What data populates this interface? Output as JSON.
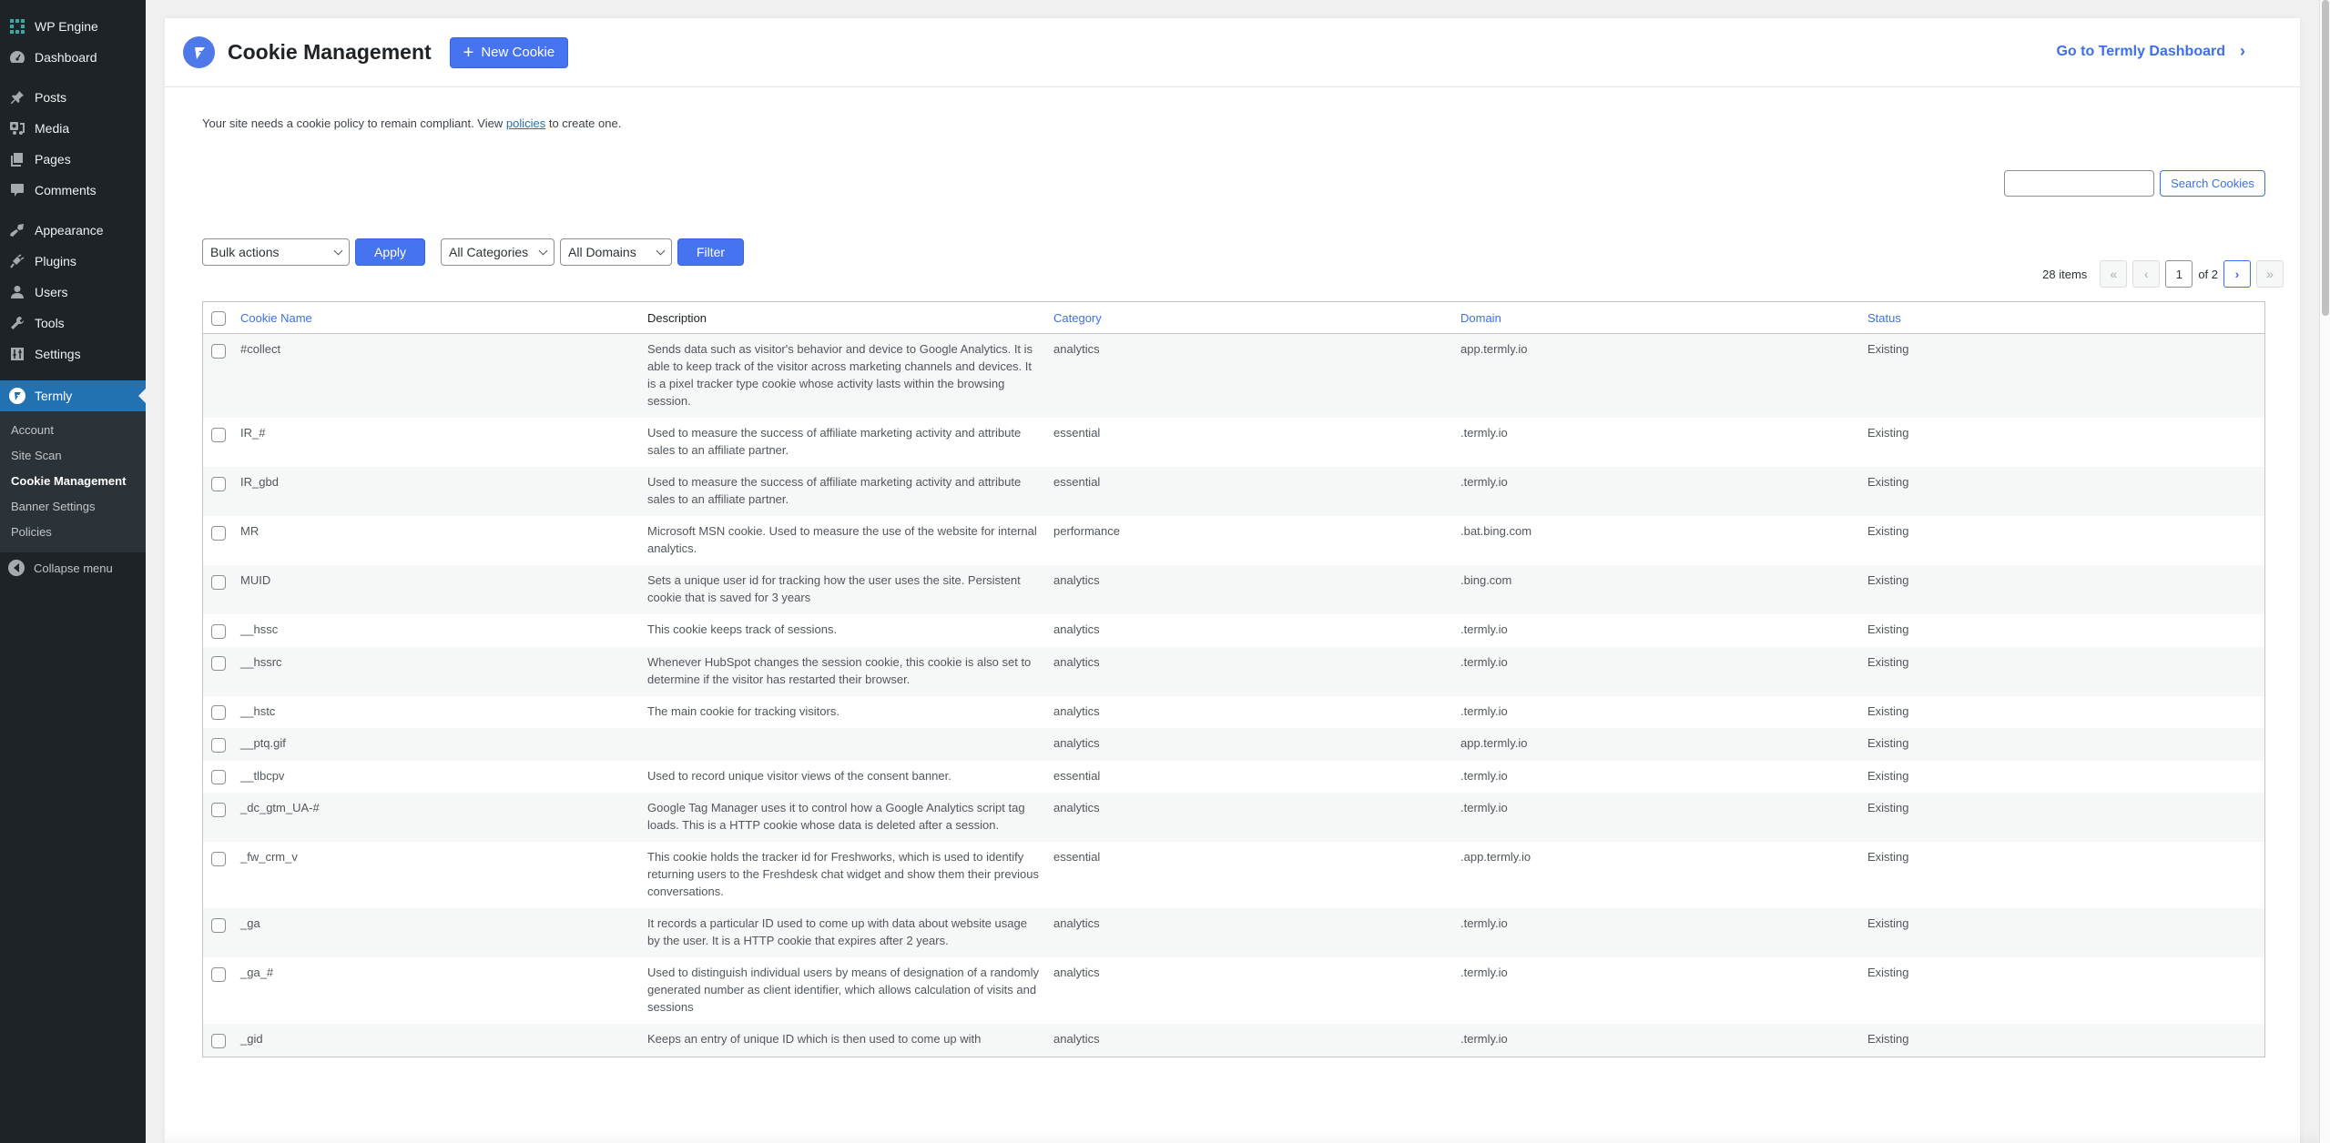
{
  "sidebar": {
    "items": [
      {
        "label": "WP Engine",
        "icon": "wp-engine-icon"
      },
      {
        "label": "Dashboard",
        "icon": "dashboard-icon"
      },
      {
        "label": "Posts",
        "icon": "pin-icon"
      },
      {
        "label": "Media",
        "icon": "media-icon"
      },
      {
        "label": "Pages",
        "icon": "pages-icon"
      },
      {
        "label": "Comments",
        "icon": "comment-icon"
      },
      {
        "label": "Appearance",
        "icon": "paintbrush-icon"
      },
      {
        "label": "Plugins",
        "icon": "plug-icon"
      },
      {
        "label": "Users",
        "icon": "user-icon"
      },
      {
        "label": "Tools",
        "icon": "wrench-icon"
      },
      {
        "label": "Settings",
        "icon": "settings-sliders-icon"
      }
    ],
    "active": {
      "label": "Termly",
      "icon": "termly-logo-icon"
    },
    "submenu": [
      {
        "label": "Account",
        "current": false
      },
      {
        "label": "Site Scan",
        "current": false
      },
      {
        "label": "Cookie Management",
        "current": true
      },
      {
        "label": "Banner Settings",
        "current": false
      },
      {
        "label": "Policies",
        "current": false
      }
    ],
    "collapse_label": "Collapse menu"
  },
  "header": {
    "title": "Cookie Management",
    "new_button": "New Cookie",
    "dashboard_link": "Go to Termly Dashboard"
  },
  "notice": {
    "before": "Your site needs a cookie policy to remain compliant. View ",
    "link": "policies",
    "after": " to create one."
  },
  "search": {
    "value": "",
    "button": "Search Cookies"
  },
  "filters": {
    "bulk_actions": "Bulk actions",
    "apply": "Apply",
    "categories": "All Categories",
    "domains": "All Domains",
    "filter": "Filter"
  },
  "pagination": {
    "items_count": "28 items",
    "current_page": "1",
    "of_pages": "of 2",
    "first": "«",
    "prev": "‹",
    "next": "›",
    "last": "»"
  },
  "table": {
    "columns": {
      "name": "Cookie Name",
      "description": "Description",
      "category": "Category",
      "domain": "Domain",
      "status": "Status"
    },
    "rows": [
      {
        "name": "#collect",
        "description": "Sends data such as visitor's behavior and device to Google Analytics. It is able to keep track of the visitor across marketing channels and devices. It is a pixel tracker type cookie whose activity lasts within the browsing session.",
        "category": "analytics",
        "domain": "app.termly.io",
        "status": "Existing"
      },
      {
        "name": "IR_#",
        "description": "Used to measure the success of affiliate marketing activity and attribute sales to an affiliate partner.",
        "category": "essential",
        "domain": ".termly.io",
        "status": "Existing"
      },
      {
        "name": "IR_gbd",
        "description": "Used to measure the success of affiliate marketing activity and attribute sales to an affiliate partner.",
        "category": "essential",
        "domain": ".termly.io",
        "status": "Existing"
      },
      {
        "name": "MR",
        "description": "Microsoft MSN cookie. Used to measure the use of the website for internal analytics.",
        "category": "performance",
        "domain": ".bat.bing.com",
        "status": "Existing"
      },
      {
        "name": "MUID",
        "description": "Sets a unique user id for tracking how the user uses the site. Persistent cookie that is saved for 3 years",
        "category": "analytics",
        "domain": ".bing.com",
        "status": "Existing"
      },
      {
        "name": "__hssc",
        "description": "This cookie keeps track of sessions.",
        "category": "analytics",
        "domain": ".termly.io",
        "status": "Existing"
      },
      {
        "name": "__hssrc",
        "description": "Whenever HubSpot changes the session cookie, this cookie is also set to determine if the visitor has restarted their browser.",
        "category": "analytics",
        "domain": ".termly.io",
        "status": "Existing"
      },
      {
        "name": "__hstc",
        "description": "The main cookie for tracking visitors.",
        "category": "analytics",
        "domain": ".termly.io",
        "status": "Existing"
      },
      {
        "name": "__ptq.gif",
        "description": "",
        "category": "analytics",
        "domain": "app.termly.io",
        "status": "Existing"
      },
      {
        "name": "__tlbcpv",
        "description": "Used to record unique visitor views of the consent banner.",
        "category": "essential",
        "domain": ".termly.io",
        "status": "Existing"
      },
      {
        "name": "_dc_gtm_UA-#",
        "description": "Google Tag Manager uses it to control how a Google Analytics script tag loads. This is a HTTP cookie whose data is deleted after a session.",
        "category": "analytics",
        "domain": ".termly.io",
        "status": "Existing"
      },
      {
        "name": "_fw_crm_v",
        "description": "This cookie holds the tracker id for Freshworks, which is used to identify returning users to the Freshdesk chat widget and show them their previous conversations.",
        "category": "essential",
        "domain": ".app.termly.io",
        "status": "Existing"
      },
      {
        "name": "_ga",
        "description": "It records a particular ID used to come up with data about website usage by the user. It is a HTTP cookie that expires after 2 years.",
        "category": "analytics",
        "domain": ".termly.io",
        "status": "Existing"
      },
      {
        "name": "_ga_#",
        "description": "Used to distinguish individual users by means of designation of a randomly generated number as client identifier, which allows calculation of visits and sessions",
        "category": "analytics",
        "domain": ".termly.io",
        "status": "Existing"
      },
      {
        "name": "_gid",
        "description": "Keeps an entry of unique ID which is then used to come up with",
        "category": "analytics",
        "domain": ".termly.io",
        "status": "Existing"
      }
    ]
  }
}
